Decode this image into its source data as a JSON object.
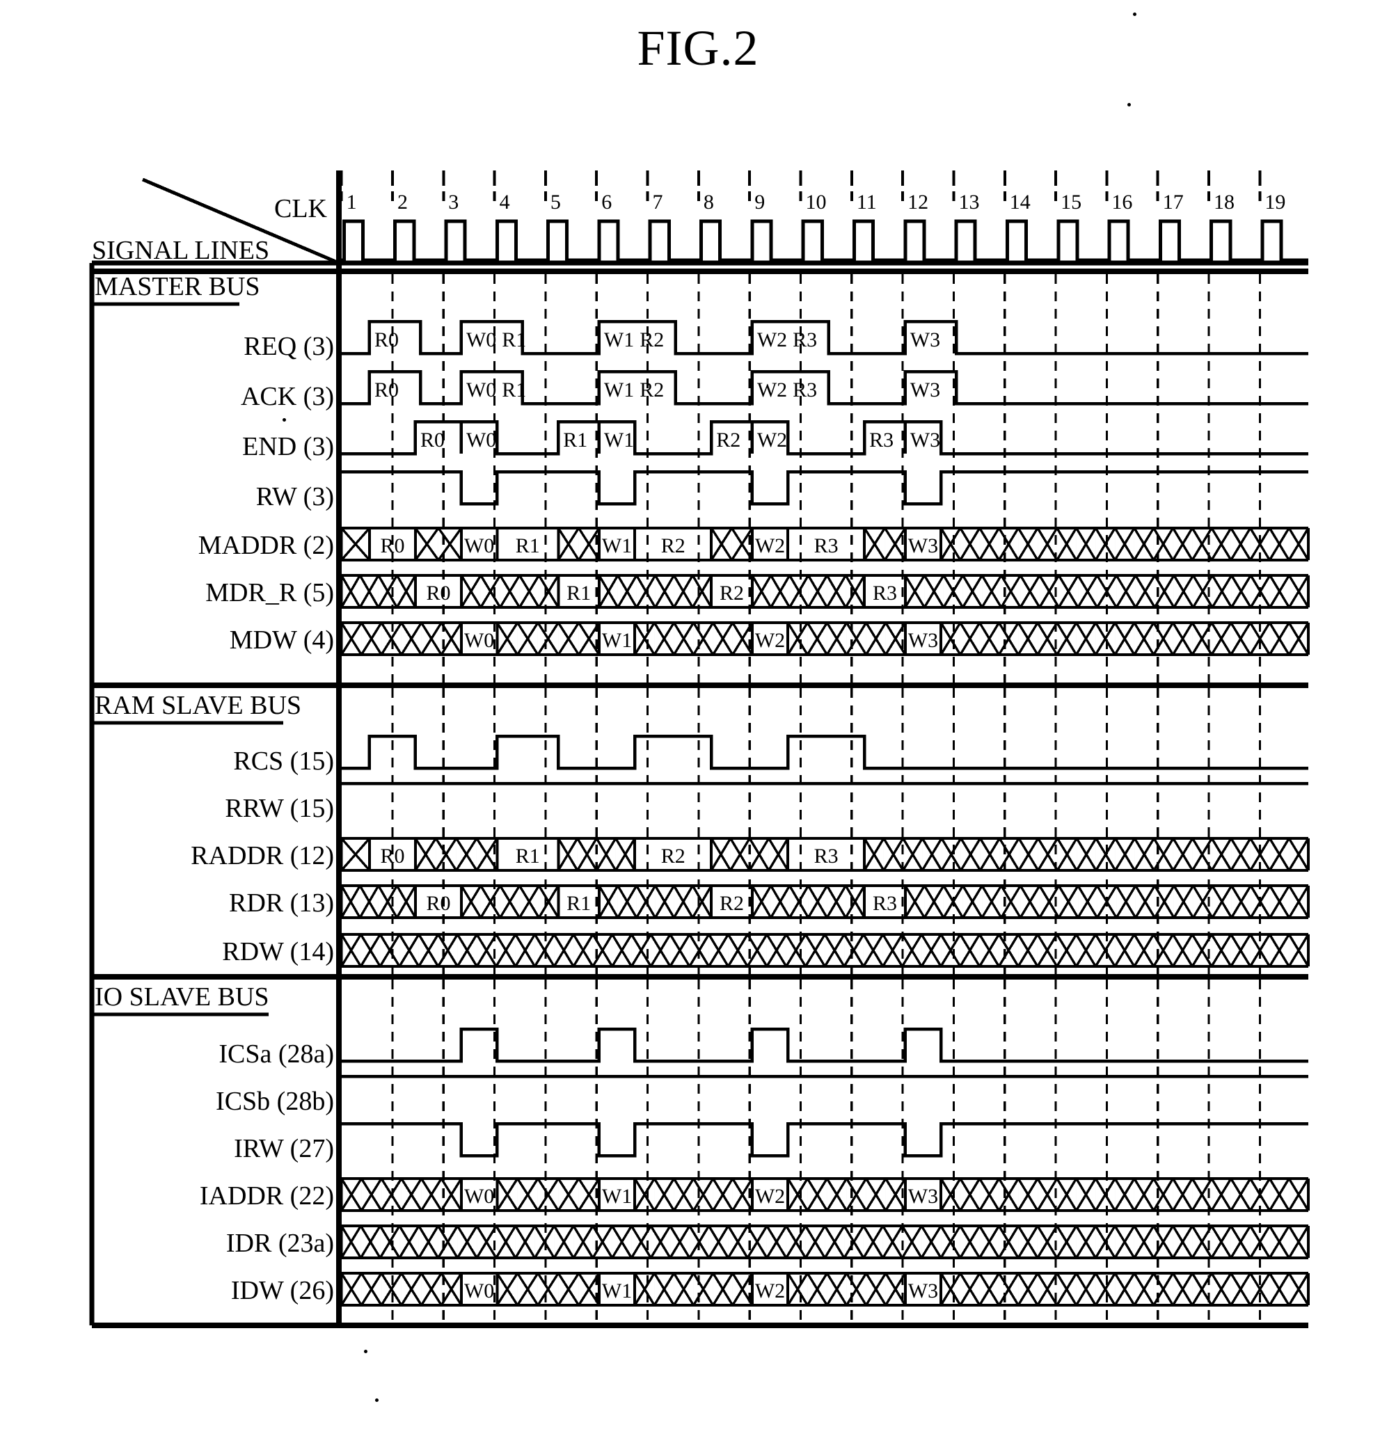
{
  "figure": {
    "title": "FIG.2",
    "corner_label_top": "CLK",
    "corner_label_bottom": "SIGNAL LINES"
  },
  "timing": {
    "cycle_numbers": [
      "1",
      "2",
      "3",
      "4",
      "5",
      "6",
      "7",
      "8",
      "9",
      "10",
      "11",
      "12",
      "13",
      "14",
      "15",
      "16",
      "17",
      "18",
      "19"
    ],
    "total_cycles": 19
  },
  "sections": [
    {
      "name": "MASTER BUS",
      "rows": [
        {
          "label": "REQ (3)",
          "type": "pulse",
          "pulses": [
            [
              0.6,
              1.6
            ],
            [
              2.4,
              3.6
            ],
            [
              5.1,
              6.6
            ],
            [
              8.1,
              9.6
            ],
            [
              11.1,
              12.1
            ]
          ],
          "labels": [
            {
              "t": 0.6,
              "text": "R0"
            },
            {
              "t": 2.4,
              "text": "W0"
            },
            {
              "t": 3.1,
              "text": "R1"
            },
            {
              "t": 5.1,
              "text": "W1"
            },
            {
              "t": 5.8,
              "text": "R2"
            },
            {
              "t": 8.1,
              "text": "W2"
            },
            {
              "t": 8.8,
              "text": "R3"
            },
            {
              "t": 11.1,
              "text": "W3"
            }
          ]
        },
        {
          "label": "ACK (3)",
          "type": "pulse",
          "pulses": [
            [
              0.6,
              1.6
            ],
            [
              2.4,
              3.6
            ],
            [
              5.1,
              6.6
            ],
            [
              8.1,
              9.6
            ],
            [
              11.1,
              12.1
            ]
          ],
          "labels": [
            {
              "t": 0.6,
              "text": "R0"
            },
            {
              "t": 2.4,
              "text": "W0"
            },
            {
              "t": 3.1,
              "text": "R1"
            },
            {
              "t": 5.1,
              "text": "W1"
            },
            {
              "t": 5.8,
              "text": "R2"
            },
            {
              "t": 8.1,
              "text": "W2"
            },
            {
              "t": 8.8,
              "text": "R3"
            },
            {
              "t": 11.1,
              "text": "W3"
            }
          ]
        },
        {
          "label": "END (3)",
          "type": "pulse",
          "pulses": [
            [
              1.5,
              2.4
            ],
            [
              2.4,
              3.1
            ],
            [
              4.3,
              5.1
            ],
            [
              5.1,
              5.8
            ],
            [
              7.3,
              8.1
            ],
            [
              8.1,
              8.8
            ],
            [
              10.3,
              11.1
            ],
            [
              11.1,
              11.8
            ]
          ],
          "labels": [
            {
              "t": 1.5,
              "text": "R0"
            },
            {
              "t": 2.4,
              "text": "W0"
            },
            {
              "t": 4.3,
              "text": "R1"
            },
            {
              "t": 5.1,
              "text": "W1"
            },
            {
              "t": 7.3,
              "text": "R2"
            },
            {
              "t": 8.1,
              "text": "W2"
            },
            {
              "t": 10.3,
              "text": "R3"
            },
            {
              "t": 11.1,
              "text": "W3"
            }
          ]
        },
        {
          "label": "RW (3)",
          "type": "pulse_low",
          "lows": [
            [
              2.4,
              3.1
            ],
            [
              5.1,
              5.8
            ],
            [
              8.1,
              8.8
            ],
            [
              11.1,
              11.8
            ]
          ],
          "labels": []
        },
        {
          "label": "MADDR (2)",
          "type": "bus",
          "segments": [
            {
              "t0": 0.05,
              "t1": 0.6,
              "text": ""
            },
            {
              "t0": 0.6,
              "t1": 1.5,
              "text": "R0"
            },
            {
              "t0": 1.5,
              "t1": 2.4,
              "text": ""
            },
            {
              "t0": 2.4,
              "t1": 3.1,
              "text": "W0"
            },
            {
              "t0": 3.1,
              "t1": 4.3,
              "text": "R1"
            },
            {
              "t0": 4.3,
              "t1": 5.1,
              "text": ""
            },
            {
              "t0": 5.1,
              "t1": 5.8,
              "text": "W1"
            },
            {
              "t0": 5.8,
              "t1": 7.3,
              "text": "R2"
            },
            {
              "t0": 7.3,
              "t1": 8.1,
              "text": ""
            },
            {
              "t0": 8.1,
              "t1": 8.8,
              "text": "W2"
            },
            {
              "t0": 8.8,
              "t1": 10.3,
              "text": "R3"
            },
            {
              "t0": 10.3,
              "t1": 11.1,
              "text": ""
            },
            {
              "t0": 11.1,
              "t1": 11.8,
              "text": "W3"
            },
            {
              "t0": 11.8,
              "t1": 19,
              "text": ""
            }
          ]
        },
        {
          "label": "MDR_R (5)",
          "type": "bus",
          "segments": [
            {
              "t0": 0.05,
              "t1": 1.5,
              "text": ""
            },
            {
              "t0": 1.5,
              "t1": 2.4,
              "text": "R0"
            },
            {
              "t0": 2.4,
              "t1": 4.3,
              "text": ""
            },
            {
              "t0": 4.3,
              "t1": 5.1,
              "text": "R1"
            },
            {
              "t0": 5.1,
              "t1": 7.3,
              "text": ""
            },
            {
              "t0": 7.3,
              "t1": 8.1,
              "text": "R2"
            },
            {
              "t0": 8.1,
              "t1": 10.3,
              "text": ""
            },
            {
              "t0": 10.3,
              "t1": 11.1,
              "text": "R3"
            },
            {
              "t0": 11.1,
              "t1": 19,
              "text": ""
            }
          ]
        },
        {
          "label": "MDW (4)",
          "type": "bus",
          "segments": [
            {
              "t0": 0.05,
              "t1": 2.4,
              "text": ""
            },
            {
              "t0": 2.4,
              "t1": 3.1,
              "text": "W0"
            },
            {
              "t0": 3.1,
              "t1": 5.1,
              "text": ""
            },
            {
              "t0": 5.1,
              "t1": 5.8,
              "text": "W1"
            },
            {
              "t0": 5.8,
              "t1": 8.1,
              "text": ""
            },
            {
              "t0": 8.1,
              "t1": 8.8,
              "text": "W2"
            },
            {
              "t0": 8.8,
              "t1": 11.1,
              "text": ""
            },
            {
              "t0": 11.1,
              "t1": 11.8,
              "text": "W3"
            },
            {
              "t0": 11.8,
              "t1": 19,
              "text": ""
            }
          ]
        }
      ]
    },
    {
      "name": "RAM SLAVE BUS",
      "rows": [
        {
          "label": "RCS (15)",
          "type": "pulse",
          "pulses": [
            [
              0.6,
              1.5
            ],
            [
              3.1,
              4.3
            ],
            [
              5.8,
              7.3
            ],
            [
              8.8,
              10.3
            ]
          ],
          "labels": []
        },
        {
          "label": "RRW (15)",
          "type": "high",
          "labels": []
        },
        {
          "label": "RADDR (12)",
          "type": "bus",
          "segments": [
            {
              "t0": 0.05,
              "t1": 0.6,
              "text": ""
            },
            {
              "t0": 0.6,
              "t1": 1.5,
              "text": "R0"
            },
            {
              "t0": 1.5,
              "t1": 3.1,
              "text": ""
            },
            {
              "t0": 3.1,
              "t1": 4.3,
              "text": "R1"
            },
            {
              "t0": 4.3,
              "t1": 5.8,
              "text": ""
            },
            {
              "t0": 5.8,
              "t1": 7.3,
              "text": "R2"
            },
            {
              "t0": 7.3,
              "t1": 8.8,
              "text": ""
            },
            {
              "t0": 8.8,
              "t1": 10.3,
              "text": "R3"
            },
            {
              "t0": 10.3,
              "t1": 19,
              "text": ""
            }
          ]
        },
        {
          "label": "RDR (13)",
          "type": "bus",
          "segments": [
            {
              "t0": 0.05,
              "t1": 1.5,
              "text": ""
            },
            {
              "t0": 1.5,
              "t1": 2.4,
              "text": "R0"
            },
            {
              "t0": 2.4,
              "t1": 4.3,
              "text": ""
            },
            {
              "t0": 4.3,
              "t1": 5.1,
              "text": "R1"
            },
            {
              "t0": 5.1,
              "t1": 7.3,
              "text": ""
            },
            {
              "t0": 7.3,
              "t1": 8.1,
              "text": "R2"
            },
            {
              "t0": 8.1,
              "t1": 10.3,
              "text": ""
            },
            {
              "t0": 10.3,
              "t1": 11.1,
              "text": "R3"
            },
            {
              "t0": 11.1,
              "t1": 19,
              "text": ""
            }
          ]
        },
        {
          "label": "RDW (14)",
          "type": "bus",
          "segments": [
            {
              "t0": 0.05,
              "t1": 19,
              "text": ""
            }
          ]
        }
      ]
    },
    {
      "name": "IO SLAVE BUS",
      "rows": [
        {
          "label": "ICSa (28a)",
          "type": "pulse",
          "pulses": [
            [
              2.4,
              3.1
            ],
            [
              5.1,
              5.8
            ],
            [
              8.1,
              8.8
            ],
            [
              11.1,
              11.8
            ]
          ],
          "labels": []
        },
        {
          "label": "ICSb (28b)",
          "type": "high",
          "labels": []
        },
        {
          "label": "IRW (27)",
          "type": "pulse_low",
          "lows": [
            [
              2.4,
              3.1
            ],
            [
              5.1,
              5.8
            ],
            [
              8.1,
              8.8
            ],
            [
              11.1,
              11.8
            ]
          ],
          "labels": []
        },
        {
          "label": "IADDR (22)",
          "type": "bus",
          "segments": [
            {
              "t0": 0.05,
              "t1": 2.4,
              "text": ""
            },
            {
              "t0": 2.4,
              "t1": 3.1,
              "text": "W0"
            },
            {
              "t0": 3.1,
              "t1": 5.1,
              "text": ""
            },
            {
              "t0": 5.1,
              "t1": 5.8,
              "text": "W1"
            },
            {
              "t0": 5.8,
              "t1": 8.1,
              "text": ""
            },
            {
              "t0": 8.1,
              "t1": 8.8,
              "text": "W2"
            },
            {
              "t0": 8.8,
              "t1": 11.1,
              "text": ""
            },
            {
              "t0": 11.1,
              "t1": 11.8,
              "text": "W3"
            },
            {
              "t0": 11.8,
              "t1": 19,
              "text": ""
            }
          ]
        },
        {
          "label": "IDR (23a)",
          "type": "bus",
          "segments": [
            {
              "t0": 0.05,
              "t1": 19,
              "text": ""
            }
          ]
        },
        {
          "label": "IDW (26)",
          "type": "bus",
          "segments": [
            {
              "t0": 0.05,
              "t1": 2.4,
              "text": ""
            },
            {
              "t0": 2.4,
              "t1": 3.1,
              "text": "W0"
            },
            {
              "t0": 3.1,
              "t1": 5.1,
              "text": ""
            },
            {
              "t0": 5.1,
              "t1": 5.8,
              "text": "W1"
            },
            {
              "t0": 5.8,
              "t1": 8.1,
              "text": ""
            },
            {
              "t0": 8.1,
              "t1": 8.8,
              "text": "W2"
            },
            {
              "t0": 8.8,
              "t1": 11.1,
              "text": ""
            },
            {
              "t0": 11.1,
              "t1": 11.8,
              "text": "W3"
            },
            {
              "t0": 11.8,
              "t1": 19,
              "text": ""
            }
          ]
        }
      ]
    }
  ],
  "colors": {
    "ink": "#000000",
    "paper": "#ffffff"
  }
}
